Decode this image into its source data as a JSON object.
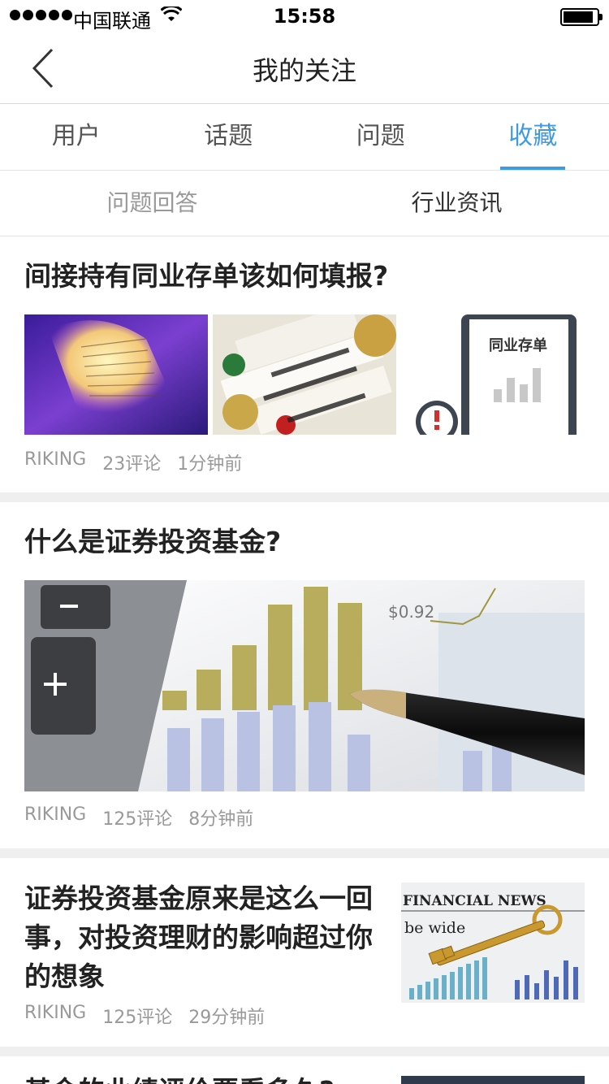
{
  "status_bar": {
    "carrier": "中国联通",
    "time": "15:58"
  },
  "navbar": {
    "title": "我的关注"
  },
  "tabs": [
    {
      "label": "用户",
      "active": false
    },
    {
      "label": "话题",
      "active": false
    },
    {
      "label": "问题",
      "active": false
    },
    {
      "label": "收藏",
      "active": true
    }
  ],
  "subtabs": [
    {
      "label": "问题回答",
      "current": false
    },
    {
      "label": "行业资讯",
      "current": true
    }
  ],
  "accent_color": "#3f9ae5",
  "articles": [
    {
      "title": "间接持有同业存单该如何填报?",
      "image_text": "同业存单",
      "author": "RIKING",
      "comments": "23评论",
      "time": "1分钟前"
    },
    {
      "title": "什么是证券投资基金?",
      "image_text": "$0.92",
      "author": "RIKING",
      "comments": "125评论",
      "time": "8分钟前"
    },
    {
      "title": "证券投资基金原来是这么一回事，对投资理财的影响超过你的想象",
      "image_text": "FINANCIAL NEWS",
      "author": "RIKING",
      "comments": "125评论",
      "time": "29分钟前"
    },
    {
      "title": "基金的业绩评价要看多久?"
    }
  ]
}
